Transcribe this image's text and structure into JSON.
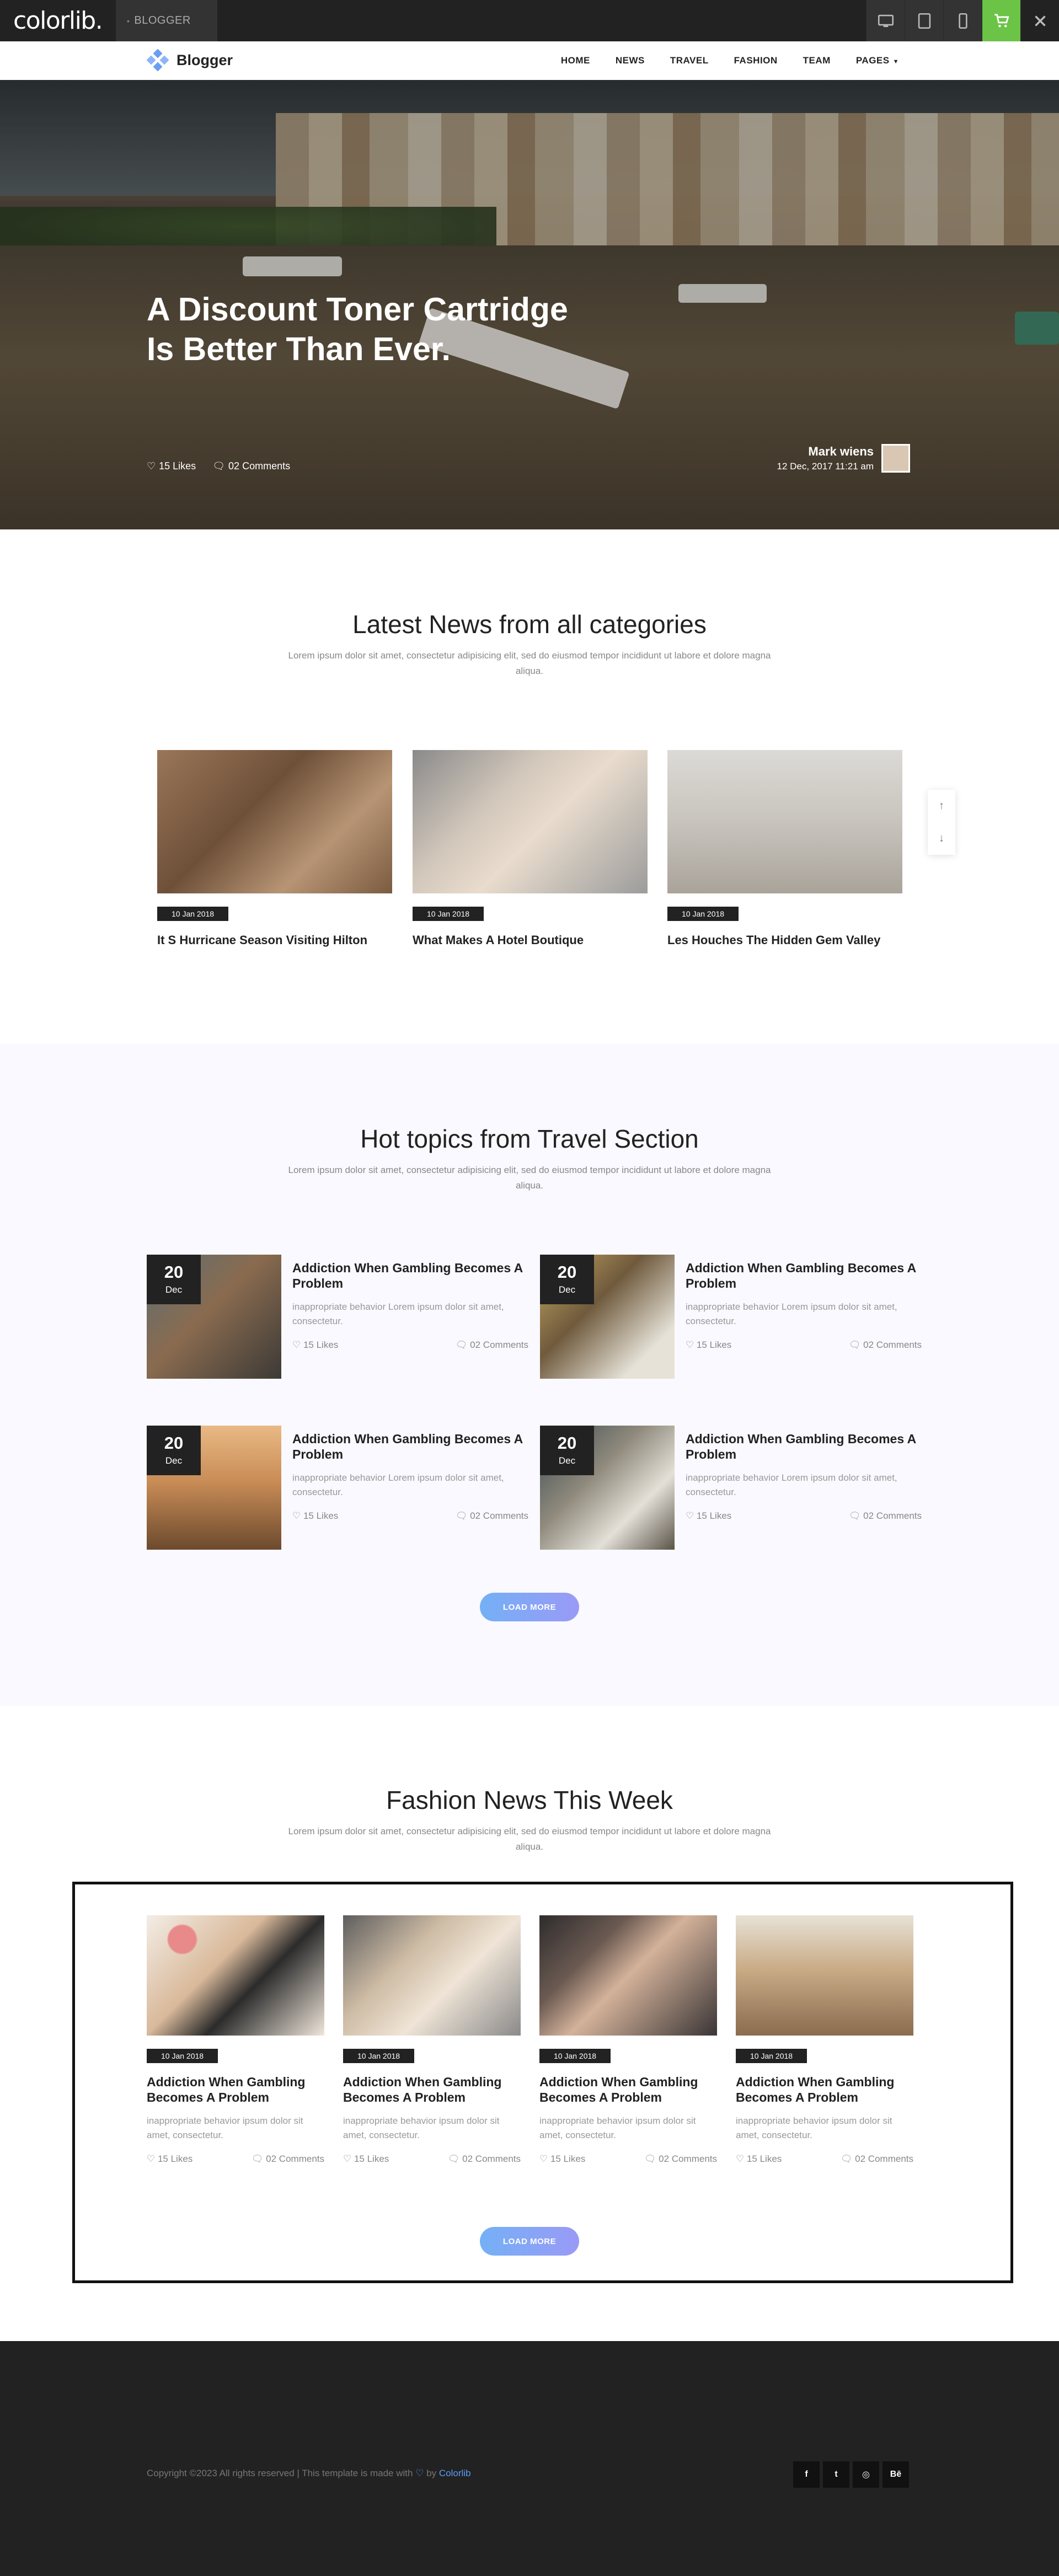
{
  "topbar": {
    "logo": "colorlib.",
    "theme_name": "BLOGGER",
    "icons": [
      "desktop-icon",
      "tablet-icon",
      "mobile-icon",
      "cart-icon",
      "close-icon"
    ],
    "cart_color": "#6bc446"
  },
  "nav": {
    "brand": "Blogger",
    "items": [
      {
        "label": "HOME"
      },
      {
        "label": "NEWS"
      },
      {
        "label": "TRAVEL"
      },
      {
        "label": "FASHION"
      },
      {
        "label": "TEAM"
      },
      {
        "label": "PAGES"
      }
    ]
  },
  "hero": {
    "title_line1": "A Discount Toner Cartridge",
    "title_line2": "Is Better Than Ever.",
    "likes": "15 Likes",
    "comments": "02 Comments",
    "author": "Mark wiens",
    "date": "12 Dec, 2017 11:21 am"
  },
  "latest": {
    "title": "Latest News from all categories",
    "subtitle": "Lorem ipsum dolor sit amet, consectetur adipisicing elit, sed do eiusmod tempor incididunt ut labore et dolore magna aliqua.",
    "cards": [
      {
        "date": "10 Jan 2018",
        "title": "It S Hurricane Season Visiting Hilton"
      },
      {
        "date": "10 Jan 2018",
        "title": "What Makes A Hotel Boutique"
      },
      {
        "date": "10 Jan 2018",
        "title": "Les Houches The Hidden Gem Valley"
      }
    ]
  },
  "hot": {
    "title": "Hot topics from Travel Section",
    "subtitle": "Lorem ipsum dolor sit amet, consectetur adipisicing elit, sed do eiusmod tempor incididunt ut labore et dolore magna aliqua.",
    "items": [
      {
        "day": "20",
        "month": "Dec",
        "title": "Addiction When Gambling Becomes A Problem",
        "text": "inappropriate behavior Lorem ipsum dolor sit amet, consectetur.",
        "likes": "15 Likes",
        "comments": "02 Comments"
      },
      {
        "day": "20",
        "month": "Dec",
        "title": "Addiction When Gambling Becomes A Problem",
        "text": "inappropriate behavior Lorem ipsum dolor sit amet, consectetur.",
        "likes": "15 Likes",
        "comments": "02 Comments"
      },
      {
        "day": "20",
        "month": "Dec",
        "title": "Addiction When Gambling Becomes A Problem",
        "text": "inappropriate behavior Lorem ipsum dolor sit amet, consectetur.",
        "likes": "15 Likes",
        "comments": "02 Comments"
      },
      {
        "day": "20",
        "month": "Dec",
        "title": "Addiction When Gambling Becomes A Problem",
        "text": "inappropriate behavior Lorem ipsum dolor sit amet, consectetur.",
        "likes": "15 Likes",
        "comments": "02 Comments"
      }
    ],
    "load_more": "LOAD MORE"
  },
  "fashion": {
    "title": "Fashion News This Week",
    "subtitle": "Lorem ipsum dolor sit amet, consectetur adipisicing elit, sed do eiusmod tempor incididunt ut labore et dolore magna aliqua.",
    "cards": [
      {
        "date": "10 Jan 2018",
        "title": "Addiction When Gambling Becomes A Problem",
        "text": "inappropriate behavior ipsum dolor sit amet, consectetur.",
        "likes": "15 Likes",
        "comments": "02 Comments"
      },
      {
        "date": "10 Jan 2018",
        "title": "Addiction When Gambling Becomes A Problem",
        "text": "inappropriate behavior ipsum dolor sit amet, consectetur.",
        "likes": "15 Likes",
        "comments": "02 Comments"
      },
      {
        "date": "10 Jan 2018",
        "title": "Addiction When Gambling Becomes A Problem",
        "text": "inappropriate behavior ipsum dolor sit amet, consectetur.",
        "likes": "15 Likes",
        "comments": "02 Comments"
      },
      {
        "date": "10 Jan 2018",
        "title": "Addiction When Gambling Becomes A Problem",
        "text": "inappropriate behavior ipsum dolor sit amet, consectetur.",
        "likes": "15 Likes",
        "comments": "02 Comments"
      }
    ],
    "load_more": "LOAD MORE"
  },
  "footer": {
    "copyright": "Copyright ©2023 All rights reserved | This template is made with",
    "by": "by",
    "link": "Colorlib",
    "social": [
      {
        "label": "f",
        "icon": "facebook-icon"
      },
      {
        "label": "t",
        "icon": "twitter-icon"
      },
      {
        "label": "◎",
        "icon": "dribbble-icon"
      },
      {
        "label": "Bē",
        "icon": "behance-icon"
      }
    ]
  }
}
